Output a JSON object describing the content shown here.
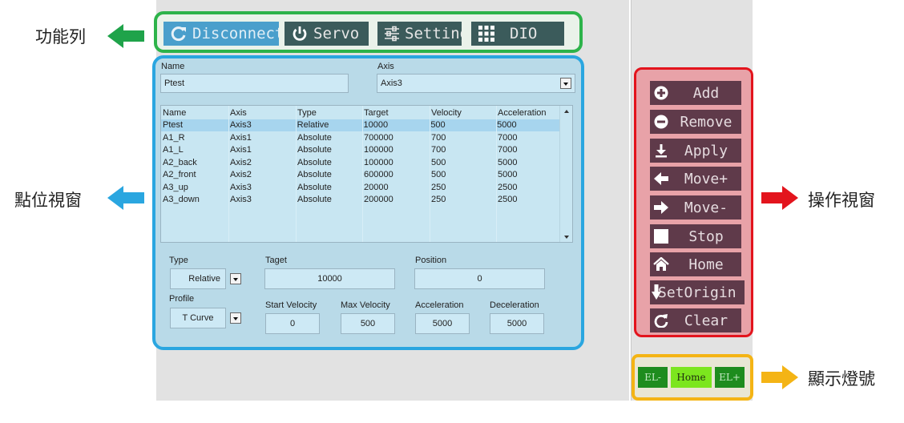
{
  "annotations": {
    "toolbar": "功能列",
    "point_window": "點位視窗",
    "operation_window": "操作視窗",
    "indicator_lights": "顯示燈號"
  },
  "colors": {
    "toolbar_border": "#2db34a",
    "point_border": "#2aa6e0",
    "operation_border": "#e3141d",
    "lights_border": "#f4b415"
  },
  "toolbar": {
    "buttons": [
      {
        "label": "Disconnect",
        "icon": "refresh-icon",
        "active": true
      },
      {
        "label": "Servo",
        "icon": "power-icon"
      },
      {
        "label": "Setting",
        "icon": "sliders-icon"
      },
      {
        "label": "DIO",
        "icon": "grid-icon"
      }
    ]
  },
  "point_form": {
    "name_label": "Name",
    "name_value": "Ptest",
    "axis_label": "Axis",
    "axis_value": "Axis3"
  },
  "table": {
    "columns": [
      "Name",
      "Axis",
      "Type",
      "Target",
      "Velocity",
      "Acceleration"
    ],
    "rows": [
      [
        "Ptest",
        "Axis3",
        "Relative",
        "10000",
        "500",
        "5000"
      ],
      [
        "A1_R",
        "Axis1",
        "Absolute",
        "700000",
        "700",
        "7000"
      ],
      [
        "A1_L",
        "Axis1",
        "Absolute",
        "100000",
        "700",
        "7000"
      ],
      [
        "A2_back",
        "Axis2",
        "Absolute",
        "100000",
        "500",
        "5000"
      ],
      [
        "A2_front",
        "Axis2",
        "Absolute",
        "600000",
        "500",
        "5000"
      ],
      [
        "A3_up",
        "Axis3",
        "Absolute",
        "20000",
        "250",
        "2500"
      ],
      [
        "A3_down",
        "Axis3",
        "Absolute",
        "200000",
        "250",
        "2500"
      ]
    ]
  },
  "motion": {
    "type_label": "Type",
    "type_value": "Relative",
    "target_label": "Taget",
    "target_value": "10000",
    "position_label": "Position",
    "position_value": "0",
    "profile_label": "Profile",
    "profile_value": "T Curve",
    "start_velocity_label": "Start Velocity",
    "start_velocity_value": "0",
    "max_velocity_label": "Max Velocity",
    "max_velocity_value": "500",
    "acceleration_label": "Acceleration",
    "acceleration_value": "5000",
    "deceleration_label": "Deceleration",
    "deceleration_value": "5000"
  },
  "operations": {
    "buttons": [
      {
        "label": "Add",
        "icon": "plus-circle-icon"
      },
      {
        "label": "Remove",
        "icon": "minus-circle-icon"
      },
      {
        "label": "Apply",
        "icon": "download-icon"
      },
      {
        "label": "Move+",
        "icon": "arrow-left-icon"
      },
      {
        "label": "Move-",
        "icon": "arrow-right-icon"
      },
      {
        "label": "Stop",
        "icon": "stop-square-icon"
      },
      {
        "label": "Home",
        "icon": "home-icon"
      },
      {
        "label": "SetOrigin",
        "icon": "arrow-down-icon"
      },
      {
        "label": "Clear",
        "icon": "reload-icon"
      }
    ]
  },
  "lights": {
    "el_minus": "EL-",
    "home": "Home",
    "el_plus": "EL+"
  }
}
